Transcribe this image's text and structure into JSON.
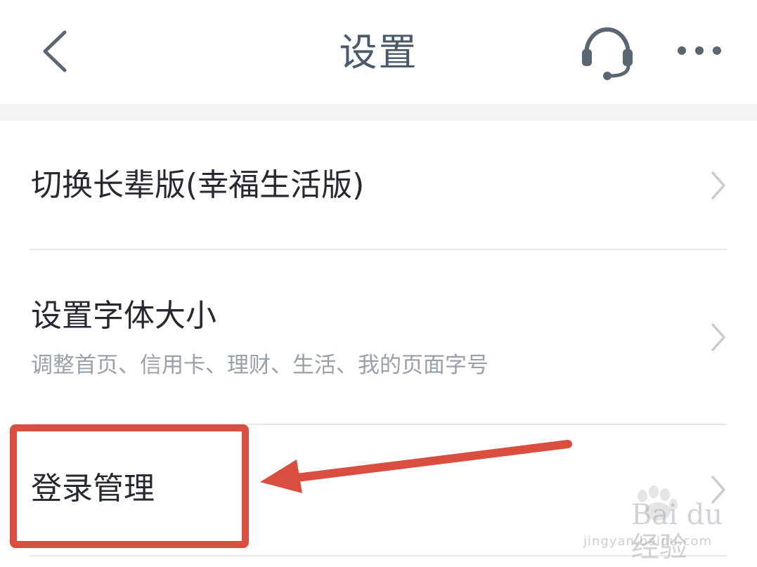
{
  "header": {
    "title": "设置"
  },
  "icons": {
    "back": "back-arrow-icon",
    "support": "headset-icon",
    "more": "more-icon",
    "chevron": "chevron-right-icon"
  },
  "settings": {
    "items": [
      {
        "label": "切换长辈版(幸福生活版)"
      },
      {
        "label": "设置字体大小",
        "subtitle": "调整首页、信用卡、理财、生活、我的页面字号"
      },
      {
        "label": "登录管理"
      }
    ]
  },
  "annotation": {
    "color": "#d94e3f"
  },
  "watermark": {
    "brand": "Bai du 经验",
    "url": "jingyan.baidu.com"
  },
  "colors": {
    "title": "#4a5a6a",
    "text": "#262a30",
    "subtext": "#9aa0a8",
    "divider": "#e6e8eb",
    "section_bg": "#f2f3f5"
  }
}
